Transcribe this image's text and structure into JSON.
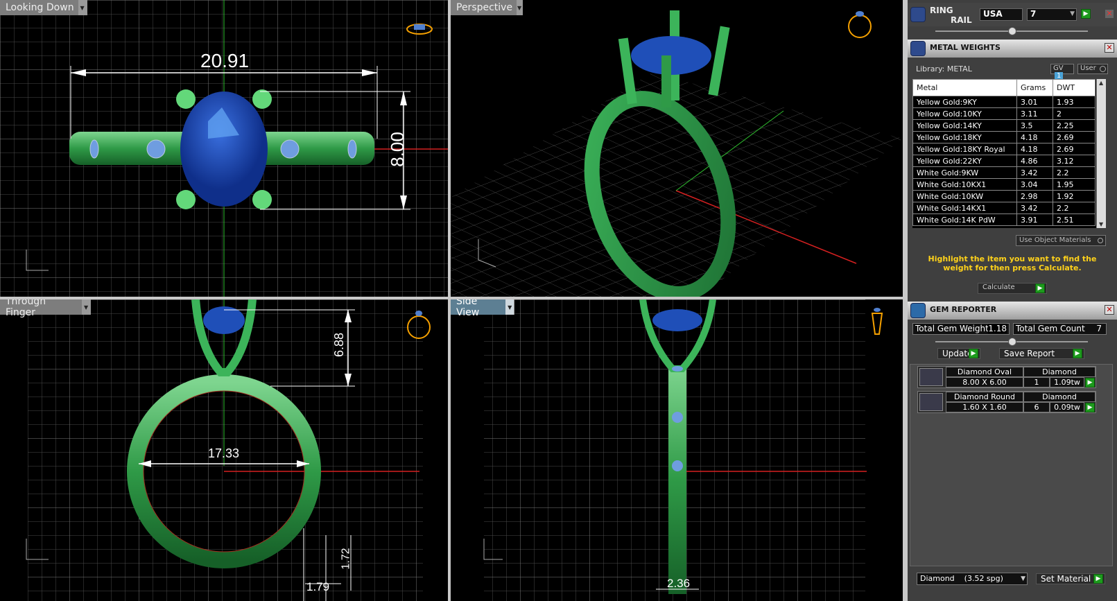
{
  "viewports": {
    "top_left": {
      "label": "Looking Down",
      "dims": {
        "width": "20.91",
        "height": "8.00"
      }
    },
    "top_right": {
      "label": "Perspective"
    },
    "bottom_left": {
      "label": "Through Finger",
      "dims": {
        "prong": "6.88",
        "inner": "17.33",
        "thick": "1.72",
        "band": "1.79"
      }
    },
    "bottom_right": {
      "label": "Side View",
      "dims": {
        "width": "2.36"
      }
    }
  },
  "ring_rail": {
    "title_line1": "RING",
    "title_line2": "RAIL",
    "region": "USA",
    "size": "7"
  },
  "metal_weights": {
    "title": "METAL WEIGHTS",
    "library_label": "Library: METAL",
    "gv_label": "GV",
    "gv_value": "1",
    "user_label": "User",
    "columns": [
      "Metal",
      "Grams",
      "DWT"
    ],
    "rows": [
      [
        "Yellow Gold:9KY",
        "3.01",
        "1.93"
      ],
      [
        "Yellow Gold:10KY",
        "3.11",
        "2"
      ],
      [
        "Yellow Gold:14KY",
        "3.5",
        "2.25"
      ],
      [
        "Yellow Gold:18KY",
        "4.18",
        "2.69"
      ],
      [
        "Yellow Gold:18KY Royal",
        "4.18",
        "2.69"
      ],
      [
        "Yellow Gold:22KY",
        "4.86",
        "3.12"
      ],
      [
        "White Gold:9KW",
        "3.42",
        "2.2"
      ],
      [
        "White Gold:10KX1",
        "3.04",
        "1.95"
      ],
      [
        "White Gold:10KW",
        "2.98",
        "1.92"
      ],
      [
        "White Gold:14KX1",
        "3.42",
        "2.2"
      ],
      [
        "White Gold:14K PdW",
        "3.91",
        "2.51"
      ]
    ],
    "use_object_materials": "Use Object Materials",
    "hint": "Highlight the item you want to find the weight for then press Calculate.",
    "calculate": "Calculate"
  },
  "gem_reporter": {
    "title": "GEM REPORTER",
    "total_weight_label": "Total Gem Weight",
    "total_weight": "1.18",
    "total_count_label": "Total Gem Count",
    "total_count": "7",
    "update": "Update",
    "save_report": "Save Report",
    "gems": [
      {
        "name": "Diamond Oval",
        "material": "Diamond",
        "size": "8.00 X 6.00",
        "count": "1",
        "weight": "1.09tw"
      },
      {
        "name": "Diamond Round",
        "material": "Diamond",
        "size": "1.60 X 1.60",
        "count": "6",
        "weight": "0.09tw"
      }
    ],
    "material_select": "Diamond    (3.52 spg)",
    "set_material": "Set Material"
  },
  "colors": {
    "ring": "#3fae57",
    "gem": "#1f4fb8",
    "grid": "#4a4a4a",
    "accent": "#f5d000"
  }
}
